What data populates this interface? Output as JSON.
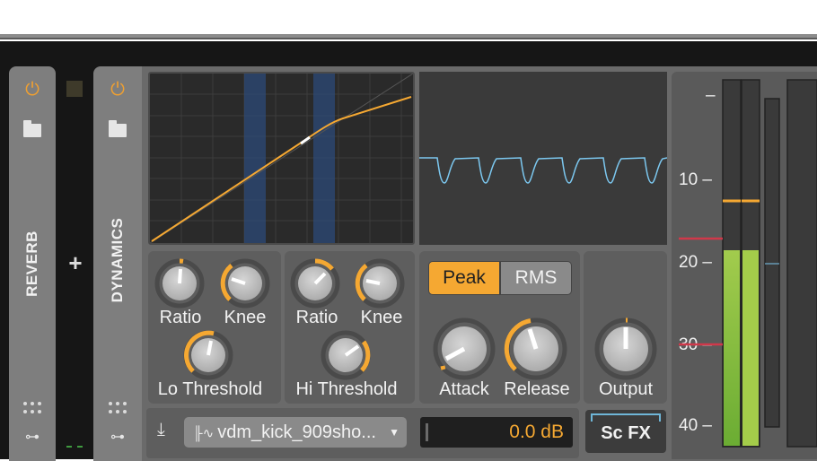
{
  "devices": {
    "reverb": {
      "name": "REVERB"
    },
    "dynamics": {
      "name": "DYNAMICS"
    }
  },
  "icons": {
    "power": "power-icon",
    "folder": "folder-icon",
    "grid": "dots-grid-icon",
    "modulator": "key-icon",
    "add": "plus-icon",
    "sidechain": "sidechain-input-icon"
  },
  "lo": {
    "ratio_label": "Ratio",
    "knee_label": "Knee",
    "threshold_label": "Lo Threshold"
  },
  "hi": {
    "ratio_label": "Ratio",
    "knee_label": "Knee",
    "threshold_label": "Hi Threshold"
  },
  "detection": {
    "peak_label": "Peak",
    "rms_label": "RMS",
    "selected": "Peak"
  },
  "envelope": {
    "attack_label": "Attack",
    "release_label": "Release"
  },
  "output": {
    "label": "Output"
  },
  "sidechain": {
    "source": "vdm_kick_909sho...",
    "gain": "0.0 dB",
    "fx_label": "Sc FX"
  },
  "meter": {
    "scale": [
      "–",
      "10 –",
      "20 –",
      "30 –",
      "40 –"
    ]
  },
  "colors": {
    "accent": "#f5a832",
    "scope_line": "#7cc8f0",
    "meter_green": "#9ccc3c",
    "threshold_red": "#d0384a"
  }
}
